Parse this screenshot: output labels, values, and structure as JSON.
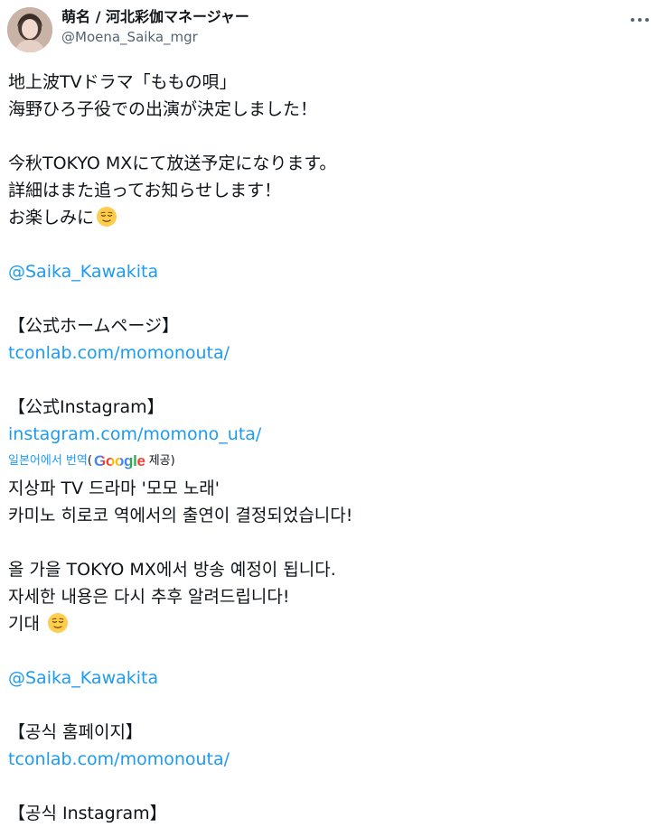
{
  "author": {
    "display_name": "萌名 / 河北彩伽マネージャー",
    "handle": "@Moena_Saika_mgr"
  },
  "tweet": {
    "line1": "地上波TVドラマ「ももの唄」",
    "line2": "海野ひろ子役での出演が決定しました！",
    "line3": "今秋TOKYO MXにて放送予定になります。",
    "line4": "詳細はまた追ってお知らせします！",
    "line5": "お楽しみに",
    "mention": "@Saika_Kawakita",
    "homepage_label": "【公式ホームページ】",
    "homepage_link": "tconlab.com/momonouta/",
    "instagram_label": "【公式Instagram】",
    "instagram_link": "instagram.com/momono_uta/"
  },
  "translation": {
    "link_text": "일본어에서 번역",
    "paren_open": "(",
    "google": "Google",
    "provided": " 제공)",
    "line1": "지상파 TV 드라마 '모모 노래'",
    "line2": "카미노 히로코 역에서의 출연이 결정되었습니다!",
    "line3": "올 가을 TOKYO MX에서 방송 예정이 됩니다.",
    "line4": "자세한 내용은 다시 추후 알려드립니다!",
    "line5": "기대",
    "mention": "@Saika_Kawakita",
    "homepage_label": "【공식 홈페이지】",
    "homepage_link": "tconlab.com/momonouta/",
    "instagram_label": "【공식 Instagram】"
  },
  "icons": {
    "emoji": "relieved-face-emoji",
    "more": "more-options-icon"
  },
  "colors": {
    "link": "#1d9bf0",
    "secondary_text": "#536471",
    "primary_text": "#0f1419"
  }
}
